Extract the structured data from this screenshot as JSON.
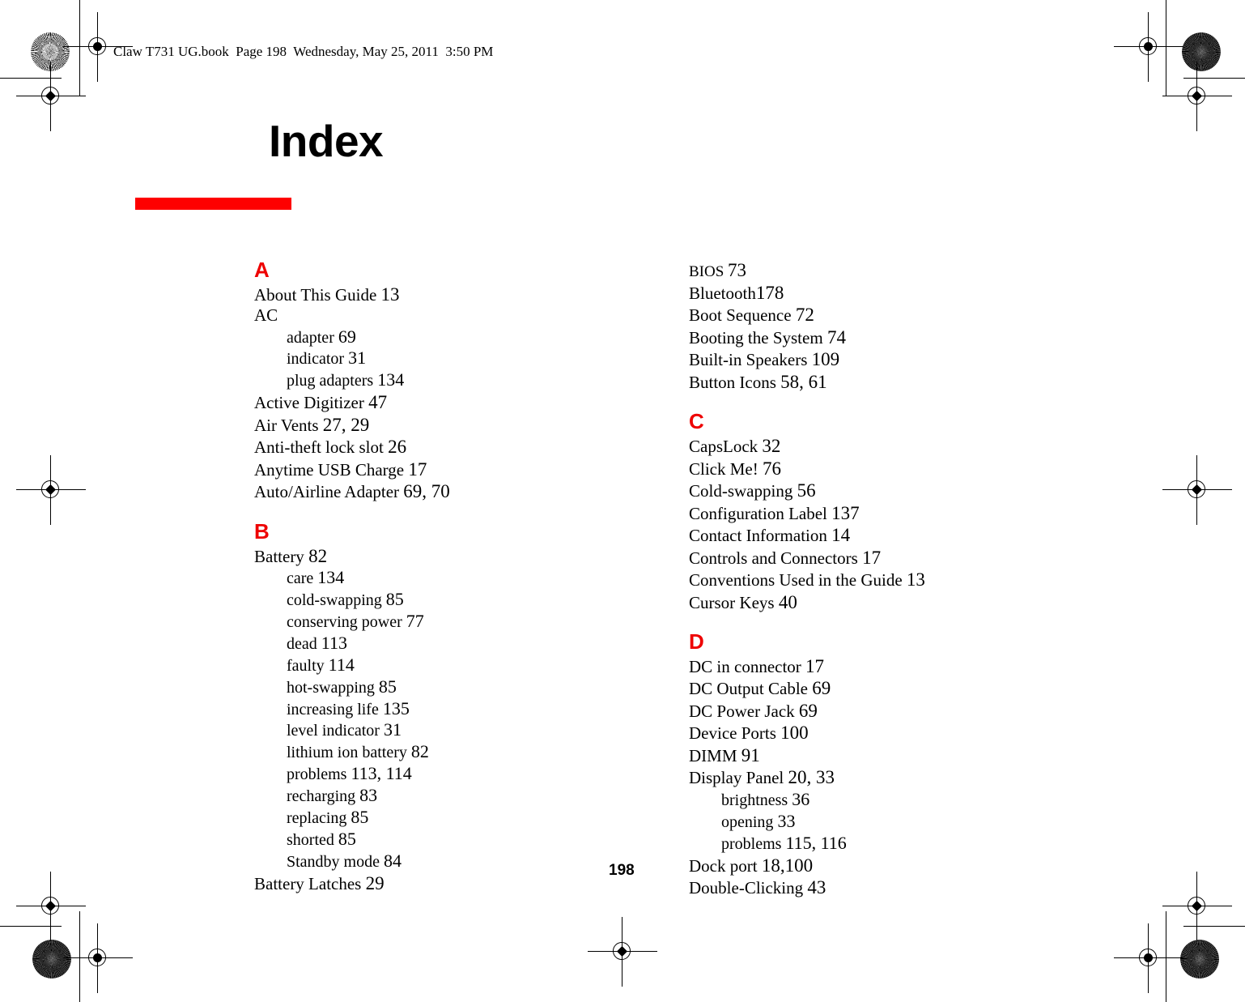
{
  "document": {
    "running_header": "Claw T731 UG.book  Page 198  Wednesday, May 25, 2011  3:50 PM",
    "title": "Index",
    "page_number": "198",
    "accent_color": "#fe0000",
    "section_color": "#ee0000"
  },
  "columns": [
    {
      "name": "left-column",
      "sections": [
        {
          "letter": "A",
          "entries": [
            {
              "text": "About This Guide ",
              "pages": "13",
              "level": 0
            },
            {
              "text": "AC",
              "pages": "",
              "level": 0
            },
            {
              "text": "adapter ",
              "pages": "69",
              "level": 1
            },
            {
              "text": "indicator ",
              "pages": "31",
              "level": 1
            },
            {
              "text": "plug adapters ",
              "pages": "134",
              "level": 1
            },
            {
              "text": "Active Digitizer ",
              "pages": "47",
              "level": 0
            },
            {
              "text": "Air Vents ",
              "pages": "27, 29",
              "level": 0
            },
            {
              "text": "Anti-theft lock slot ",
              "pages": "26",
              "level": 0
            },
            {
              "text": "Anytime USB Charge ",
              "pages": "17",
              "level": 0
            },
            {
              "text": "Auto/Airline Adapter ",
              "pages": "69, 70",
              "level": 0
            }
          ]
        },
        {
          "letter": "B",
          "entries": [
            {
              "text": "Battery ",
              "pages": "82",
              "level": 0
            },
            {
              "text": "care ",
              "pages": "134",
              "level": 1
            },
            {
              "text": "cold-swapping ",
              "pages": "85",
              "level": 1
            },
            {
              "text": "conserving power ",
              "pages": "77",
              "level": 1
            },
            {
              "text": "dead ",
              "pages": "113",
              "level": 1
            },
            {
              "text": "faulty ",
              "pages": "114",
              "level": 1
            },
            {
              "text": "hot-swapping ",
              "pages": "85",
              "level": 1
            },
            {
              "text": "increasing life ",
              "pages": "135",
              "level": 1
            },
            {
              "text": "level indicator ",
              "pages": "31",
              "level": 1
            },
            {
              "text": "lithium ion battery ",
              "pages": "82",
              "level": 1
            },
            {
              "text": "problems ",
              "pages": "113, 114",
              "level": 1
            },
            {
              "text": "recharging ",
              "pages": "83",
              "level": 1
            },
            {
              "text": "replacing ",
              "pages": "85",
              "level": 1
            },
            {
              "text": "shorted ",
              "pages": "85",
              "level": 1
            },
            {
              "text": "Standby mode ",
              "pages": "84",
              "level": 1
            },
            {
              "text": "Battery Latches ",
              "pages": "29",
              "level": 0
            }
          ]
        }
      ]
    },
    {
      "name": "right-column",
      "sections": [
        {
          "letter": "",
          "entries": [
            {
              "text": "BIOS ",
              "pages": "73",
              "level": 0,
              "smallcaps": true
            },
            {
              "text": "Bluetooth",
              "pages": "178",
              "level": 0
            },
            {
              "text": "Boot Sequence ",
              "pages": "72",
              "level": 0
            },
            {
              "text": "Booting the System ",
              "pages": "74",
              "level": 0
            },
            {
              "text": "Built-in Speakers ",
              "pages": "109",
              "level": 0
            },
            {
              "text": "Button Icons ",
              "pages": "58, 61",
              "level": 0
            }
          ]
        },
        {
          "letter": "C",
          "entries": [
            {
              "text": "CapsLock ",
              "pages": "32",
              "level": 0
            },
            {
              "text": "Click Me! ",
              "pages": "76",
              "level": 0
            },
            {
              "text": "Cold-swapping ",
              "pages": "56",
              "level": 0
            },
            {
              "text": "Configuration Label ",
              "pages": "137",
              "level": 0
            },
            {
              "text": "Contact Information ",
              "pages": "14",
              "level": 0
            },
            {
              "text": "Controls and Connectors ",
              "pages": "17",
              "level": 0
            },
            {
              "text": "Conventions Used in the Guide ",
              "pages": "13",
              "level": 0
            },
            {
              "text": "Cursor Keys ",
              "pages": "40",
              "level": 0
            }
          ]
        },
        {
          "letter": "D",
          "entries": [
            {
              "text": "DC in connector ",
              "pages": "17",
              "level": 0
            },
            {
              "text": "DC Output Cable ",
              "pages": "69",
              "level": 0
            },
            {
              "text": "DC Power Jack ",
              "pages": "69",
              "level": 0
            },
            {
              "text": "Device Ports ",
              "pages": "100",
              "level": 0
            },
            {
              "text": "DIMM ",
              "pages": "91",
              "level": 0
            },
            {
              "text": "Display Panel ",
              "pages": "20, 33",
              "level": 0
            },
            {
              "text": "brightness ",
              "pages": "36",
              "level": 1
            },
            {
              "text": "opening ",
              "pages": "33",
              "level": 1
            },
            {
              "text": "problems ",
              "pages": "115, 116",
              "level": 1
            },
            {
              "text": "Dock port ",
              "pages": "18,100",
              "level": 0
            },
            {
              "text": "Double-Clicking ",
              "pages": "43",
              "level": 0
            }
          ]
        }
      ]
    }
  ]
}
